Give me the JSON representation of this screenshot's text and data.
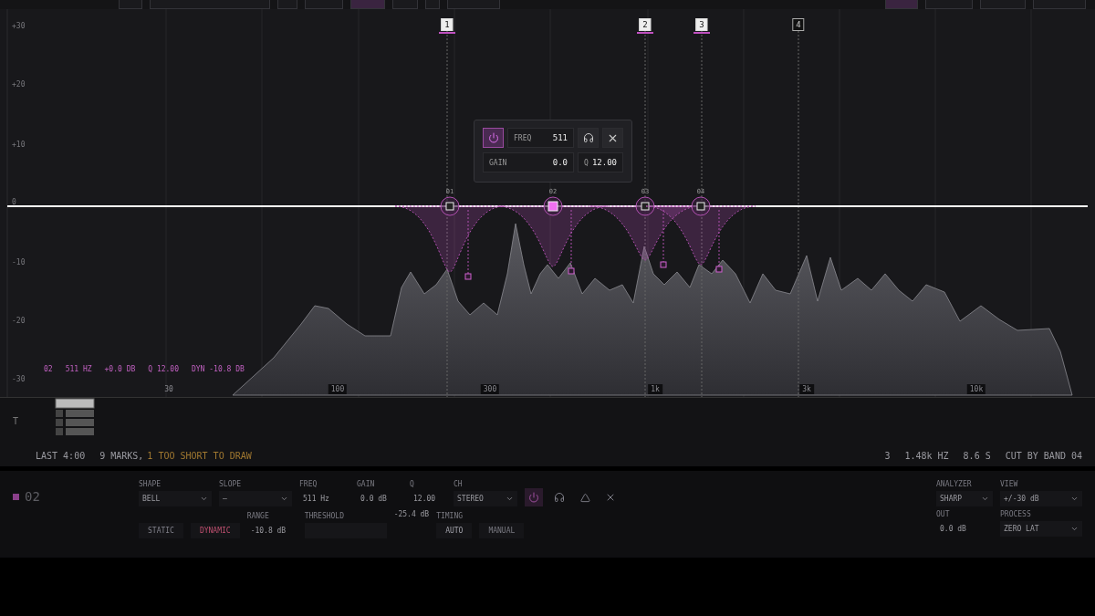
{
  "toolbar": {
    "buttons": [
      {
        "selected": false
      },
      {
        "selected": false
      },
      {
        "selected": false
      },
      {
        "selected": false
      },
      {
        "selected": true
      },
      {
        "selected": false
      },
      {
        "selected": false
      },
      {
        "selected": false
      }
    ],
    "right_buttons": [
      {
        "selected": true
      },
      {
        "selected": false
      },
      {
        "selected": false
      },
      {
        "selected": false
      }
    ]
  },
  "graph": {
    "db_labels": [
      "+30",
      "+20",
      "+10",
      "0",
      "-10",
      "-20",
      "-30"
    ],
    "freq_labels": [
      {
        "label": "30",
        "boxed": false
      },
      {
        "label": "100",
        "boxed": true
      },
      {
        "label": "300",
        "boxed": true
      },
      {
        "label": "1k",
        "boxed": true
      },
      {
        "label": "3k",
        "boxed": true
      },
      {
        "label": "10k",
        "boxed": true
      }
    ],
    "markers": [
      {
        "label": "1",
        "active": true
      },
      {
        "label": "2",
        "active": true
      },
      {
        "label": "3",
        "active": true
      },
      {
        "label": "4",
        "active": false
      }
    ],
    "nodes": [
      {
        "label": "01",
        "selected": false
      },
      {
        "label": "02",
        "selected": true
      },
      {
        "label": "03",
        "selected": false
      },
      {
        "label": "04",
        "selected": false
      }
    ],
    "readout": [
      "02",
      "511 HZ",
      "+0.0 DB",
      "Q 12.00",
      "DYN -10.8 DB"
    ],
    "popup": {
      "power": {
        "selected": true
      },
      "freq": {
        "label": "FREQ",
        "value": "511"
      },
      "gain": {
        "label": "GAIN",
        "value": "0.0"
      },
      "q": {
        "label": "Q",
        "value": "12.00"
      }
    }
  },
  "timeline": {
    "track_label": "T",
    "last": "LAST 4:00",
    "marks": "9 MARKS,",
    "warning": "1 TOO SHORT TO DRAW",
    "stats": [
      "3",
      "1.48k HZ",
      "8.6 S",
      "CUT BY BAND 04"
    ]
  },
  "panel": {
    "band": {
      "label": "02",
      "color": "#8a3f8a"
    },
    "fields": [
      {
        "label": "SHAPE",
        "value": "BELL",
        "kind": "dropdown"
      },
      {
        "label": "SLOPE",
        "value": "—",
        "kind": "dropdown"
      },
      {
        "label": "FREQ",
        "value": "511",
        "unit": "Hz",
        "kind": "number"
      },
      {
        "label": "GAIN",
        "value": "0.0",
        "unit": "dB",
        "kind": "number"
      },
      {
        "label": "Q",
        "value": "12.00",
        "kind": "number"
      },
      {
        "label": "CH",
        "value": "STEREO",
        "kind": "dropdown"
      }
    ],
    "actions": [
      {
        "kind": "power",
        "selected": true
      },
      {
        "kind": "listen",
        "selected": false
      },
      {
        "kind": "warning",
        "selected": false
      },
      {
        "kind": "remove",
        "selected": false
      }
    ],
    "mode": [
      {
        "label": "STATIC",
        "selected": false
      },
      {
        "label": "DYNAMIC",
        "selected": true
      }
    ],
    "range": {
      "label": "RANGE",
      "value": "-10.8 dB"
    },
    "threshold": {
      "label": "THRESHOLD",
      "reading": "-25.4 dB"
    },
    "timing": {
      "label": "TIMING",
      "options": [
        {
          "label": "AUTO",
          "selected": true
        },
        {
          "label": "MANUAL",
          "selected": false
        }
      ]
    },
    "analyzer": {
      "label": "ANALYZER",
      "value": "SHARP"
    },
    "view": {
      "label": "VIEW",
      "value": "+/-30 dB"
    },
    "out": {
      "label": "OUT",
      "value": "0.0 dB"
    },
    "process": {
      "label": "PROCESS",
      "value": "ZERO LAT"
    }
  }
}
